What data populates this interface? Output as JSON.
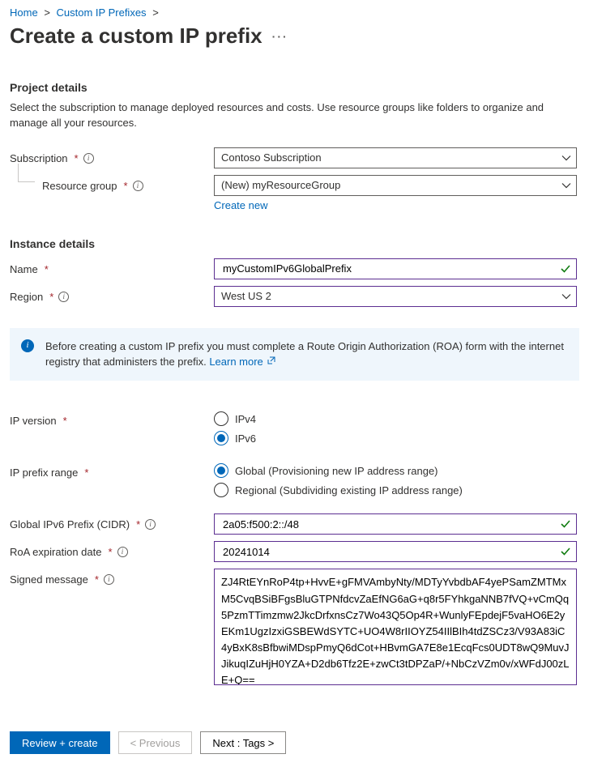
{
  "breadcrumb": {
    "home": "Home",
    "cip": "Custom IP Prefixes"
  },
  "title": "Create a custom IP prefix",
  "project": {
    "heading": "Project details",
    "desc": "Select the subscription to manage deployed resources and costs. Use resource groups like folders to organize and manage all your resources.",
    "subscription_label": "Subscription",
    "subscription_value": "Contoso Subscription",
    "rg_label": "Resource group",
    "rg_value": "(New) myResourceGroup",
    "create_new": "Create new"
  },
  "instance": {
    "heading": "Instance details",
    "name_label": "Name",
    "name_value": "myCustomIPv6GlobalPrefix",
    "region_label": "Region",
    "region_value": "West US 2"
  },
  "info_box": {
    "text": "Before creating a custom IP prefix you must complete a Route Origin Authorization (ROA) form with the internet registry that administers the prefix. ",
    "learn": "Learn more"
  },
  "ipversion": {
    "label": "IP version",
    "opt4": "IPv4",
    "opt6": "IPv6"
  },
  "range": {
    "label": "IP prefix range",
    "global": "Global (Provisioning new IP address range)",
    "regional": "Regional (Subdividing existing IP address range)"
  },
  "cidr": {
    "label": "Global IPv6 Prefix (CIDR)",
    "value": "2a05:f500:2::/48"
  },
  "roa": {
    "label": "RoA expiration date",
    "value": "20241014"
  },
  "signed": {
    "label": "Signed message",
    "value": "ZJ4RtEYnRoP4tp+HvvE+gFMVAmbyNty/MDTyYvbdbAF4yePSamZMTMxM5CvqBSiBFgsBluGTPNfdcvZaEfNG6aG+q8r5FYhkgaNNB7fVQ+vCmQq5PzmTTimzmw2JkcDrfxnsCz7Wo43Q5Op4R+WunlyFEpdejF5vaHO6E2yEKm1UgzIzxiGSBEWdSYTC+UO4W8rIIOYZ54IIlBIh4tdZSCz3/V93A83iC4yBxK8sBfbwiMDspPmyQ6dCot+HBvmGA7E8e1EcqFcs0UDT8wQ9MuvJJikuqIZuHjH0YZA+D2db6Tfz2E+zwCt3tDPZaP/+NbCzVZm0v/xWFdJ00zLE+Q=="
  },
  "footer": {
    "review": "Review + create",
    "prev": "< Previous",
    "next": "Next : Tags >"
  }
}
